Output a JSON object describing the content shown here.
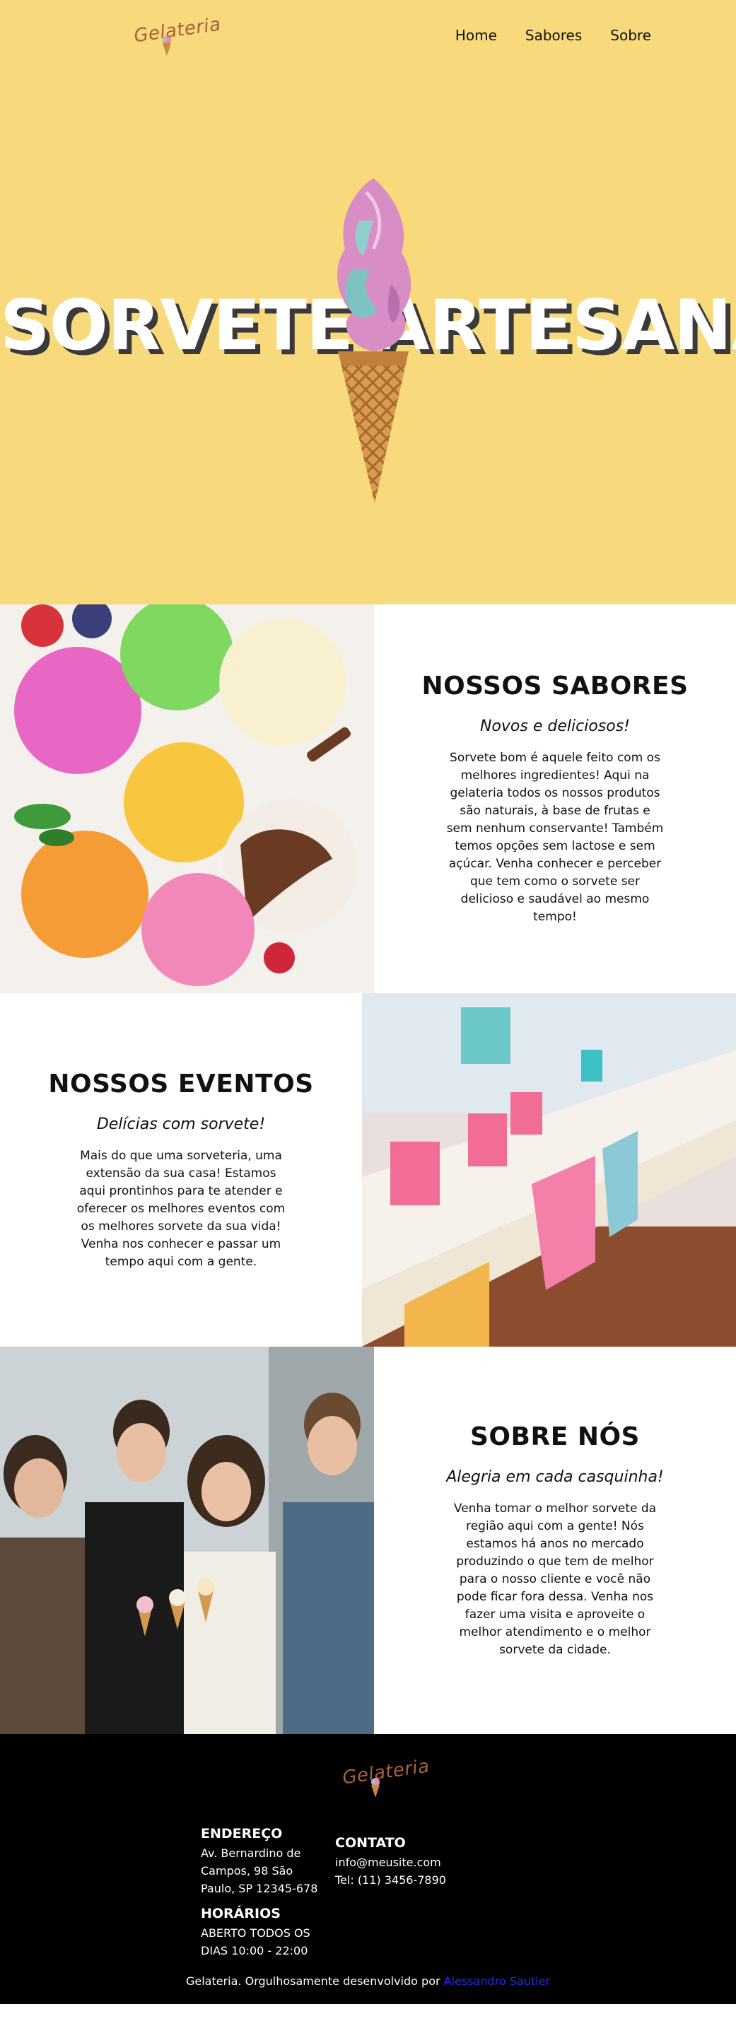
{
  "brand": {
    "logo_text": "Gelateria",
    "accent": "#f8d97c",
    "logo_color": "#a4613a"
  },
  "nav": {
    "items": [
      "Home",
      "Sabores",
      "Sobre"
    ]
  },
  "hero": {
    "title": "SORVETE ARTESANAL",
    "cone_icon": "ice-cream-cone-icon"
  },
  "sections": [
    {
      "title": "NOSSOS SABORES",
      "subtitle": "Novos e deliciosos!",
      "body": "Sorvete bom é aquele feito com os melhores ingredientes! Aqui na gelateria todos os nossos produtos são naturais, à base de frutas e sem nenhum conservante! Também temos opções sem lactose e sem açúcar. Venha conhecer e perceber que tem como o sorvete ser delicioso e saudável ao mesmo tempo!"
    },
    {
      "title": "NOSSOS EVENTOS",
      "subtitle": "Delícias com sorvete!",
      "body": "Mais do que uma sorveteria, uma extensão da sua casa! Estamos aqui prontinhos para te atender e oferecer os melhores eventos com os melhores sorvete da sua vida! Venha nos conhecer e passar um tempo aqui com a gente."
    },
    {
      "title": "SOBRE NÓS",
      "subtitle": "Alegria em cada casquinha!",
      "body": "Venha tomar o melhor sorvete da região aqui com a gente! Nós estamos há anos no mercado produzindo o que tem de melhor para o nosso cliente e você não pode ficar fora dessa. Venha nos fazer uma visita e aproveite o melhor atendimento e o melhor sorvete da cidade."
    }
  ],
  "footer": {
    "address_heading": "ENDEREÇO",
    "address": "Av. Bernardino de Campos, 98 São Paulo, SP 12345-678",
    "hours_heading": "HORÁRIOS",
    "hours": "ABERTO TODOS OS DIAS 10:00 - 22:00",
    "contact_heading": "CONTATO",
    "email": "info@meusite.com",
    "phone": "Tel: (11) 3456-7890",
    "credit_text": "Gelateria. Orgulhosamente desenvolvido por",
    "credit_link": "Alessandro Sautier"
  }
}
